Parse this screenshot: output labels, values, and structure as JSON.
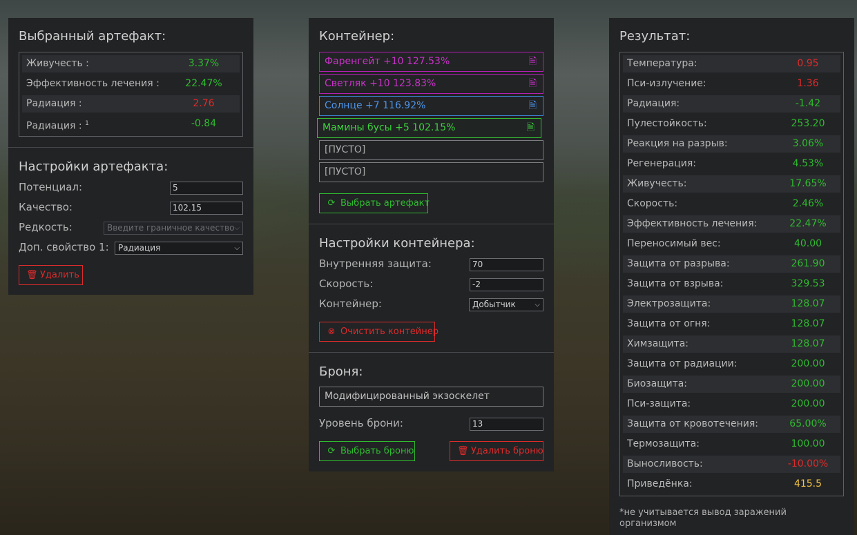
{
  "selected": {
    "title": "Выбранный артефакт:",
    "stats": [
      {
        "label": "Живучесть :",
        "value": "3.37%",
        "color": "green"
      },
      {
        "label": "Эффективность лечения :",
        "value": "22.47%",
        "color": "green"
      },
      {
        "label": "Радиация :",
        "value": "2.76",
        "color": "red"
      },
      {
        "label": "Радиация :",
        "sup": "1",
        "value": "-0.84",
        "color": "green"
      }
    ]
  },
  "settings": {
    "title": "Настройки артефакта:",
    "potential_label": "Потенциал:",
    "potential_value": "5",
    "quality_label": "Качество:",
    "quality_value": "102.15",
    "rarity_label": "Редкость:",
    "rarity_value": "Введите граничное качество",
    "extra_label": "Доп. свойство 1:",
    "extra_value": "Радиация",
    "delete_label": "Удалить"
  },
  "container": {
    "title": "Контейнер:",
    "slots": [
      {
        "text": "Фаренгейт +10 127.53%",
        "style": "mag"
      },
      {
        "text": "Светляк +10 123.83%",
        "style": "mag"
      },
      {
        "text": "Солнце +7 116.92%",
        "style": "blue"
      },
      {
        "text": "Мамины бусы +5 102.15%",
        "style": "green"
      },
      {
        "text": "[ПУСТО]",
        "style": "empty"
      },
      {
        "text": "[ПУСТО]",
        "style": "empty"
      }
    ],
    "choose_label": "Выбрать артефакт"
  },
  "container_settings": {
    "title": "Настройки контейнера:",
    "protection_label": "Внутренняя защита:",
    "protection_value": "70",
    "speed_label": "Скорость:",
    "speed_value": "-2",
    "container_label": "Контейнер:",
    "container_value": "Добытчик",
    "clear_label": "Очистить контейнер"
  },
  "armor": {
    "title": "Броня:",
    "name": "Модифицированный экзоскелет",
    "level_label": "Уровень брони:",
    "level_value": "13",
    "choose_label": "Выбрать броню",
    "delete_label": "Удалить броню"
  },
  "result": {
    "title": "Результат:",
    "stats": [
      {
        "label": "Температура:",
        "value": "0.95",
        "color": "red"
      },
      {
        "label": "Пси-излучение:",
        "value": "1.36",
        "color": "red"
      },
      {
        "label": "Радиация:",
        "value": "-1.42",
        "color": "green"
      },
      {
        "label": "Пулестойкость:",
        "value": "253.20",
        "color": "green"
      },
      {
        "label": "Реакция на разрыв:",
        "value": "3.06%",
        "color": "green"
      },
      {
        "label": "Регенерация:",
        "value": "4.53%",
        "color": "green"
      },
      {
        "label": "Живучесть:",
        "value": "17.65%",
        "color": "green"
      },
      {
        "label": "Скорость:",
        "value": "2.46%",
        "color": "green"
      },
      {
        "label": "Эффективность лечения:",
        "value": "22.47%",
        "color": "green"
      },
      {
        "label": "Переносимый вес:",
        "value": "40.00",
        "color": "green"
      },
      {
        "label": "Защита от разрыва:",
        "value": "261.90",
        "color": "green"
      },
      {
        "label": "Защита от взрыва:",
        "value": "329.53",
        "color": "green"
      },
      {
        "label": "Электрозащита:",
        "value": "128.07",
        "color": "green"
      },
      {
        "label": "Защита от огня:",
        "value": "128.07",
        "color": "green"
      },
      {
        "label": "Химзащита:",
        "value": "128.07",
        "color": "green"
      },
      {
        "label": "Защита от радиации:",
        "value": "200.00",
        "color": "green"
      },
      {
        "label": "Биозащита:",
        "value": "200.00",
        "color": "green"
      },
      {
        "label": "Пси-защита:",
        "value": "200.00",
        "color": "green"
      },
      {
        "label": "Защита от кровотечения:",
        "value": "65.00%",
        "color": "green"
      },
      {
        "label": "Термозащита:",
        "value": "100.00",
        "color": "green"
      },
      {
        "label": "Выносливость:",
        "value": "-10.00%",
        "color": "red"
      },
      {
        "label": "Приведёнка:",
        "value": "415.5",
        "color": "yellow"
      }
    ],
    "footnote": "*не учитывается вывод заражений организмом"
  }
}
